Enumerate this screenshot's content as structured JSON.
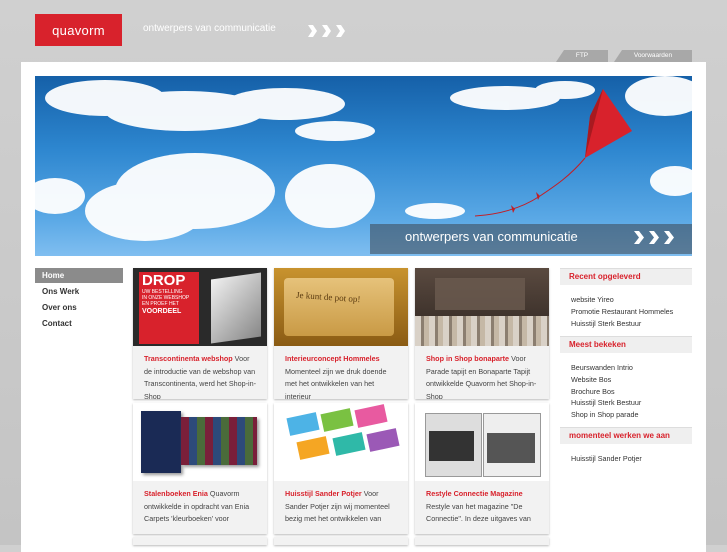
{
  "header": {
    "logo": "quavorm",
    "tagline": "ontwerpers van communicatie",
    "tabs": [
      "FTP",
      "Voorwaarden"
    ]
  },
  "hero": {
    "caption": "ontwerpers van communicatie"
  },
  "nav": [
    "Home",
    "Ons Werk",
    "Over ons",
    "Contact"
  ],
  "cards": [
    {
      "title": "Transcontinenta webshop",
      "text": "Voor de introductie van de webshop van Transcontinenta, werd het Shop-in-Shop"
    },
    {
      "title": "Interieurconcept Hommeles",
      "text": "Momenteel zijn we druk doende met het ontwikkelen van het interieur"
    },
    {
      "title": "Shop in Shop bonaparte",
      "text": "Voor Parade tapijt en Bonaparte Tapijt ontwikkelde Quavorm het Shop-in-Shop"
    },
    {
      "title": "Stalenboeken Enia",
      "text": "Quavorm ontwikkelde in opdracht van Enia Carpets 'kleurboeken' voor"
    },
    {
      "title": "Huisstijl Sander Potjer",
      "text": "Voor Sander Potjer zijn wij momenteel bezig met het ontwikkelen van"
    },
    {
      "title": "Restyle Connectie Magazine",
      "text": "Restyle van het magazine \"De Connectie\". In deze uitgaves van"
    }
  ],
  "thumbs": {
    "drop_lines": [
      "DROP",
      "UW BESTELLING",
      "IN ONZE WEBSHOP",
      "EN PROEF HET",
      "VOORDEEL"
    ],
    "wall_text": "Je kunt de pot op!"
  },
  "sidebar": [
    {
      "title": "Recent opgeleverd",
      "items": [
        "website Yireo",
        "Promotie Restaurant Hommeles",
        "Huisstijl Sterk Bestuur"
      ]
    },
    {
      "title": "Meest bekeken",
      "items": [
        "Beurswanden Intrio",
        "Website Bos",
        "Brochure Bos",
        "Huisstijl Sterk Bestuur",
        "Shop in Shop parade"
      ]
    },
    {
      "title": "momenteel werken we aan",
      "items": [
        "Huisstijl Sander Potjer"
      ]
    }
  ],
  "colors": {
    "brand_red": "#d8222c",
    "nav_active": "#8b8b8b",
    "sky": "#2d86cf"
  }
}
